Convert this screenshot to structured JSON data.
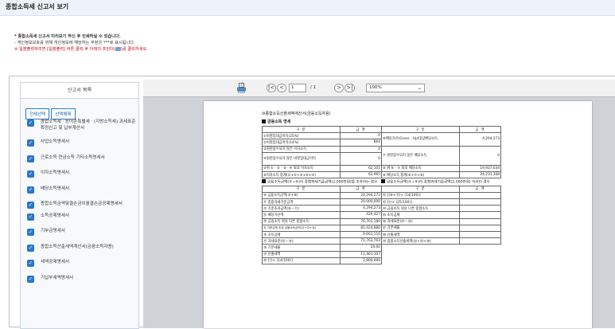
{
  "page": {
    "title": "종합소득세 신고서 보기"
  },
  "notice": {
    "line1": "* 종합소득세 신고서 미리보기 하신 후 인쇄하실 수 있습니다.",
    "line2": "- 개인정보보호를 위해 개인정보에 해당하는 부분은 ***로 표시됩니다.",
    "line3_pre": "※ 일괄출력하려면 [일괄출력] 버튼 클릭 후 아래의 프린터(",
    "line3_post": ")를 클릭하세요."
  },
  "sidebar": {
    "title": "신고서 목록",
    "select_all": "전체선택",
    "deselect": "선택해제",
    "items": [
      {
        "label": "종합소득세ㆍ농어촌특별세ㆍ(지방소득세) 과세표준확정신고 및 납부계산서"
      },
      {
        "label": "사업소득명세서"
      },
      {
        "label": "근로소득 연금소득 기타소득명세서"
      },
      {
        "label": "이자소득명세서"
      },
      {
        "label": "배당소득명세서"
      },
      {
        "label": "종합소득금액및결손금이월결손금공제명세서"
      },
      {
        "label": "소득공제명세서"
      },
      {
        "label": "기부금명세서"
      },
      {
        "label": "종합소득산출세액계산서(금융소득자용)"
      },
      {
        "label": "세액공제명세서"
      },
      {
        "label": "기납부세액명세서"
      }
    ]
  },
  "viewer": {
    "page_current": "1",
    "page_total": "/ 1",
    "zoom": "100%",
    "nav_first": "|<",
    "nav_prev": "<",
    "nav_next": ">",
    "nav_last": ">|"
  },
  "doc": {
    "caption": "⑩종합소득산출세액계산서(금융소득자용)",
    "section1": "금융소득 명세",
    "hdr_gubun": "구 분",
    "hdr_amount": "금 액",
    "rows1": [
      {
        "l": "①비영업대금이익(25%)",
        "lv": "0",
        "r": "⑥배당가산(Gross - Up)대상배당소득",
        "rv": "4,294,273"
      },
      {
        "l": "②비영업대금이익(14%)",
        "lv": "864",
        "r": "",
        "rv": ""
      },
      {
        "l": "③원천징수되지 않은 이자소득",
        "lv": "0",
        "r": "⑦ 원천징수되지 않은 배당소득",
        "rv": "0"
      },
      {
        "l": "④원천징수되지 않은 비영업대금이익",
        "lv": "0",
        "r": "",
        "rv": ""
      },
      {
        "l": "⑤위 ①ㆍ②ㆍ③ㆍ④ 외의 이자소득",
        "lv": "62,101",
        "r": "⑧ 위 ⑥ㆍ⑦ 외의 배당소득",
        "rv": "19,937,034"
      },
      {
        "l": "⑥이자소득 합계(①+②+③+④+⑤)",
        "lv": "62,965",
        "r": "⑨ 배당소득 합계(⑥+⑦+⑧)",
        "rv": "24,231,308"
      }
    ],
    "section2_left": "금융소득금액(⑤+⑨)이 종합과세기준금액(2,000만원)을 초과하는 경우",
    "section2_right": "금융소득금액(⑤+⑨)이 종합과세기준금액(2,000만원) 이하인 경우",
    "rows2": [
      {
        "l": "⑩ 금융소득금액(⑤+⑨)",
        "lv": "24,294,273",
        "r": "㉒ [(⑩+⑪)× (14/100)]",
        "rv": ""
      },
      {
        "l": "⑪ 종합과세기준금액",
        "lv": "20,000,000",
        "r": "㉓ [⑫× (25/100)]",
        "rv": ""
      },
      {
        "l": "⑫ 기준초과금액(⑩－⑪)",
        "lv": "4,294,273",
        "r": "㉔ 금융소득 외의 다른 종합소득",
        "rv": ""
      },
      {
        "l": "⑬ 배당가산액",
        "lv": "429,427",
        "r": "㉕ 소득공제",
        "rv": ""
      },
      {
        "l": "⑭ 금융소득 외의 다른 종합소득",
        "lv": "76,701,180",
        "r": "㉖ 과세표준(㉔－㉕)",
        "rv": ""
      },
      {
        "l": "⑮ 기준금액 초과 금융소득금액(⑫+⑬+⑭)",
        "lv": "81,424,880",
        "r": "㉗ 기본세율",
        "rv": ""
      },
      {
        "l": "⑯ 소득공제",
        "lv": "9,661,110",
        "r": "㉘ 산출세액",
        "rv": ""
      },
      {
        "l": "⑰ 과세표준(⑮－⑯)",
        "lv": "71,763,763",
        "r": "㉙ 종합소득산출세액(㉒+㉓+㉘)",
        "rv": ""
      },
      {
        "l": "⑱ 기본세율",
        "lv": "24.00",
        "r": "",
        "rv": ""
      },
      {
        "l": "⑲ 산출세액",
        "lv": "11,463,307",
        "r": "",
        "rv": ""
      },
      {
        "l": "⑳ [⑪× (14/100)]",
        "lv": "2,800,000",
        "r": "",
        "rv": ""
      }
    ]
  },
  "colors": {
    "accent": "#2a76cf",
    "red": "#d0021b",
    "viewer_bg": "#cfd3d8"
  }
}
